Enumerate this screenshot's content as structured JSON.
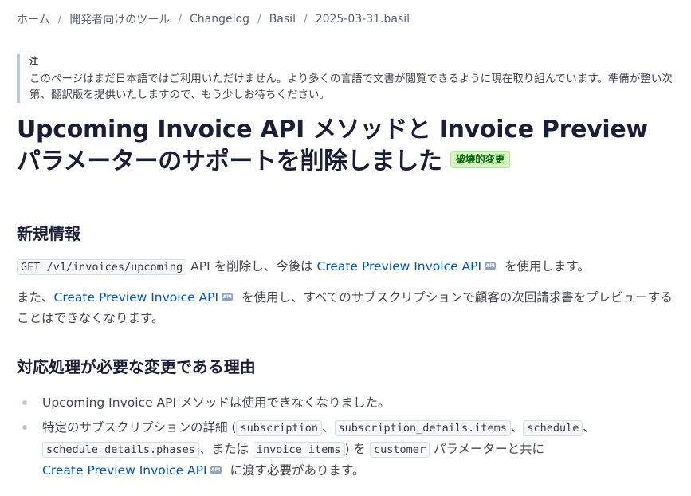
{
  "breadcrumb": {
    "items": [
      "ホーム",
      "開発者向けのツール",
      "Changelog",
      "Basil",
      "2025-03-31.basil"
    ],
    "separator": "/"
  },
  "note": {
    "label": "注",
    "text": "このページはまだ日本語ではご利用いただけません。より多くの言語で文書が閲覧できるように現在取り組んでいます。準備が整い次第、翻訳版を提供いたしますので、もう少しお待ちください。"
  },
  "title": {
    "line1": "Upcoming Invoice API メソッドと Invoice Preview",
    "line2": "パラメーターのサポートを削除しました",
    "badge": "破壊的変更"
  },
  "whats_new": {
    "heading": "新規情報",
    "p1": {
      "code": "GET /v1/invoices/upcoming",
      "text_a": " API を削除し、今後は ",
      "link": "Create Preview Invoice API",
      "text_b": " を使用します。"
    },
    "p2": {
      "text_a": "また、",
      "link": "Create Preview Invoice API",
      "text_b": " を使用し、すべてのサブスクリプションで顧客の次回請求書をプレビューすることはできなくなります。"
    }
  },
  "why": {
    "heading": "対応処理が必要な変更である理由",
    "item1": "Upcoming Invoice API メソッドは使用できなくなりました。",
    "item2": {
      "text_a": "特定のサブスクリプションの詳細 (",
      "code1": "subscription",
      "sep1": "、",
      "code2": "subscription_details.items",
      "sep2": "、",
      "code3": "schedule",
      "sep3": "、",
      "code4": "schedule_details.phases",
      "text_b": "、または ",
      "code5": "invoice_items",
      "text_c": ") を ",
      "code6": "customer",
      "text_d": " パラメーターと共に",
      "link": "Create Preview Invoice API",
      "text_e": " に渡す必要があります。"
    }
  },
  "icons": {
    "api_badge": "API",
    "api_icon": "api-icon",
    "bullet": "bullet-icon"
  },
  "colors": {
    "link": "#0055bc",
    "badge_bg": "#d7f7c2",
    "badge_text": "#006908",
    "note_border": "#c0c8d2"
  }
}
